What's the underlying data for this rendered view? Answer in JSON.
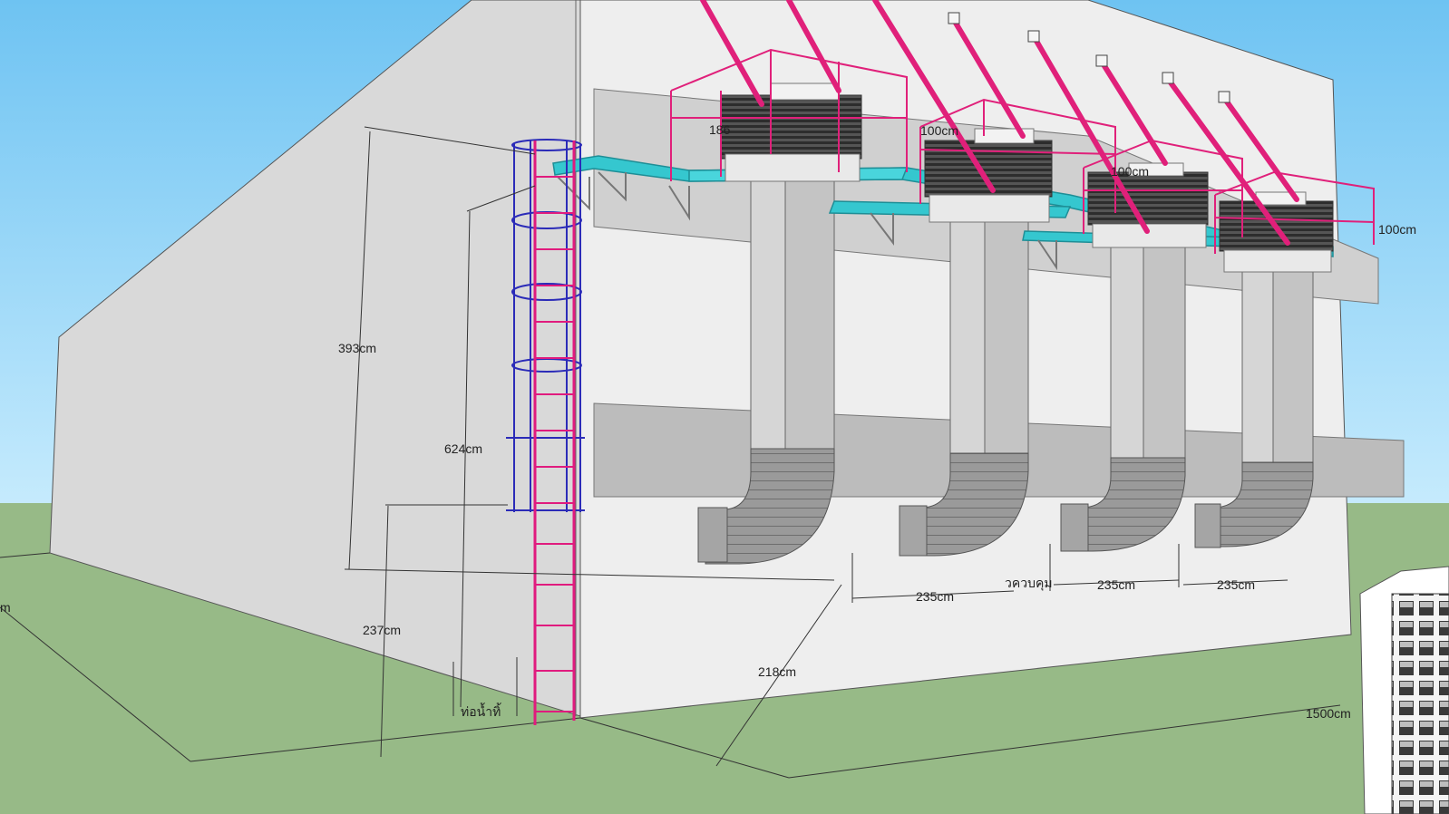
{
  "colors": {
    "sky_top": "#6ec3f2",
    "sky_bottom": "#b9e3fb",
    "ground": "#97ba87",
    "wall_front": "#ececec",
    "wall_side": "#d8d8d8",
    "band": "#bdbdbd",
    "duct": "#c2c2c2",
    "duct_dark": "#8f8f8f",
    "magenta": "#e0207a",
    "cyan": "#35c7cf",
    "ladder_cage": "#2b2bb8",
    "ladder_rungs": "#e01b7e"
  },
  "dimensions": {
    "height_393": "393cm",
    "height_624": "624cm",
    "height_237": "237cm",
    "depth_218": "218cm",
    "span_235_a": "235cm",
    "span_235_b": "235cm",
    "span_235_c": "235cm",
    "length_1500": "1500cm",
    "unit_186": "186",
    "unit_100_a": "100cm",
    "unit_100_b": "100cm",
    "unit_100_c": "100cm",
    "partial_m": "m"
  },
  "annotations": {
    "drain_pipe": "ท่อน้ำทิ้",
    "control_label": "วควบคุม"
  },
  "icons": {
    "ladder": "ladder-icon",
    "evaporative_cooler": "cooler-unit-icon",
    "air_duct": "duct-icon",
    "louver_panel": "louver-icon"
  }
}
